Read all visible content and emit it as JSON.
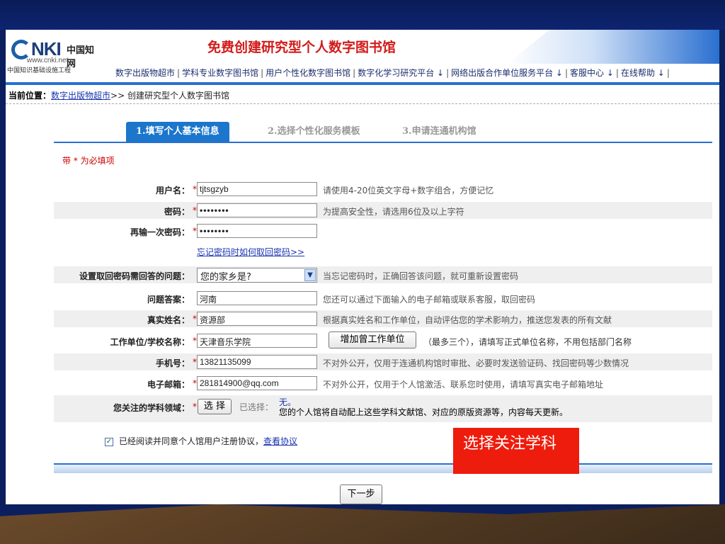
{
  "header": {
    "logo_nki": "NKI",
    "logo_cn": "中国知网",
    "logo_url": "www.cnki.net",
    "logo_sub": "中国知识基础设施工程",
    "title": "免费创建研究型个人数字图书馆",
    "nav": [
      "数字出版物超市",
      "学科专业数字图书馆",
      "用户个性化数字图书馆",
      "数字化学习研究平台 ↓",
      "网络出版合作单位服务平台 ↓",
      "客服中心 ↓",
      "在线帮助 ↓"
    ]
  },
  "breadcrumb": {
    "label": "当前位置：",
    "link": "数字出版物超市",
    "rest": ">> 创建研究型个人数字图书馆"
  },
  "tabs": [
    "1.填写个人基本信息",
    "2.选择个性化服务模板",
    "3.申请连通机构馆"
  ],
  "required_note": "带 * 为必填项",
  "form": {
    "username": {
      "label": "用户名：",
      "value": "tjtsgzyb",
      "hint": "请使用4-20位英文字母+数字组合，方便记忆"
    },
    "password": {
      "label": "密码：",
      "value": "••••••••",
      "hint": "为提高安全性，请选用6位及以上字符"
    },
    "password2": {
      "label": "再输一次密码：",
      "value": "••••••••"
    },
    "forgot_link": "忘记密码时如何取回密码>>",
    "question": {
      "label": "设置取回密码需回答的问题：",
      "value": "您的家乡是?",
      "hint": "当忘记密码时，正确回答该问题，就可重新设置密码"
    },
    "answer": {
      "label": "问题答案：",
      "value": "河南",
      "hint": "您还可以通过下面输入的电子邮箱或联系客服，取回密码"
    },
    "realname": {
      "label": "真实姓名：",
      "value": "资源部",
      "hint": "根据真实姓名和工作单位，自动评估您的学术影响力，推送您发表的所有文献"
    },
    "org": {
      "label": "工作单位/学校名称：",
      "value": "天津音乐学院",
      "button": "增加曾工作单位",
      "hint": "（最多三个），请填写正式单位名称，不用包括部门名称"
    },
    "phone": {
      "label": "手机号：",
      "value": "13821135099",
      "hint": "不对外公开，仅用于连通机构馆时审批、必要时发送验证码、找回密码等少数情况"
    },
    "email": {
      "label": "电子邮箱：",
      "value": "281814900@qq.com",
      "hint": "不对外公开，仅用于个人馆激活、联系您时使用，请填写真实电子邮箱地址"
    },
    "subject": {
      "label": "您关注的学科领域：",
      "button": "选 择",
      "selected_label": "已选择：",
      "selected_value": "无。",
      "hint": "您的个人馆将自动配上这些学科文献馆、对应的原版资源等，内容每天更新。"
    }
  },
  "agreement": {
    "checkbox": "✓",
    "text": "已经阅读并同意个人馆用户注册协议，",
    "link": "查看协议"
  },
  "annotation": "选择关注学科",
  "next_button": "下一步",
  "star": "*"
}
